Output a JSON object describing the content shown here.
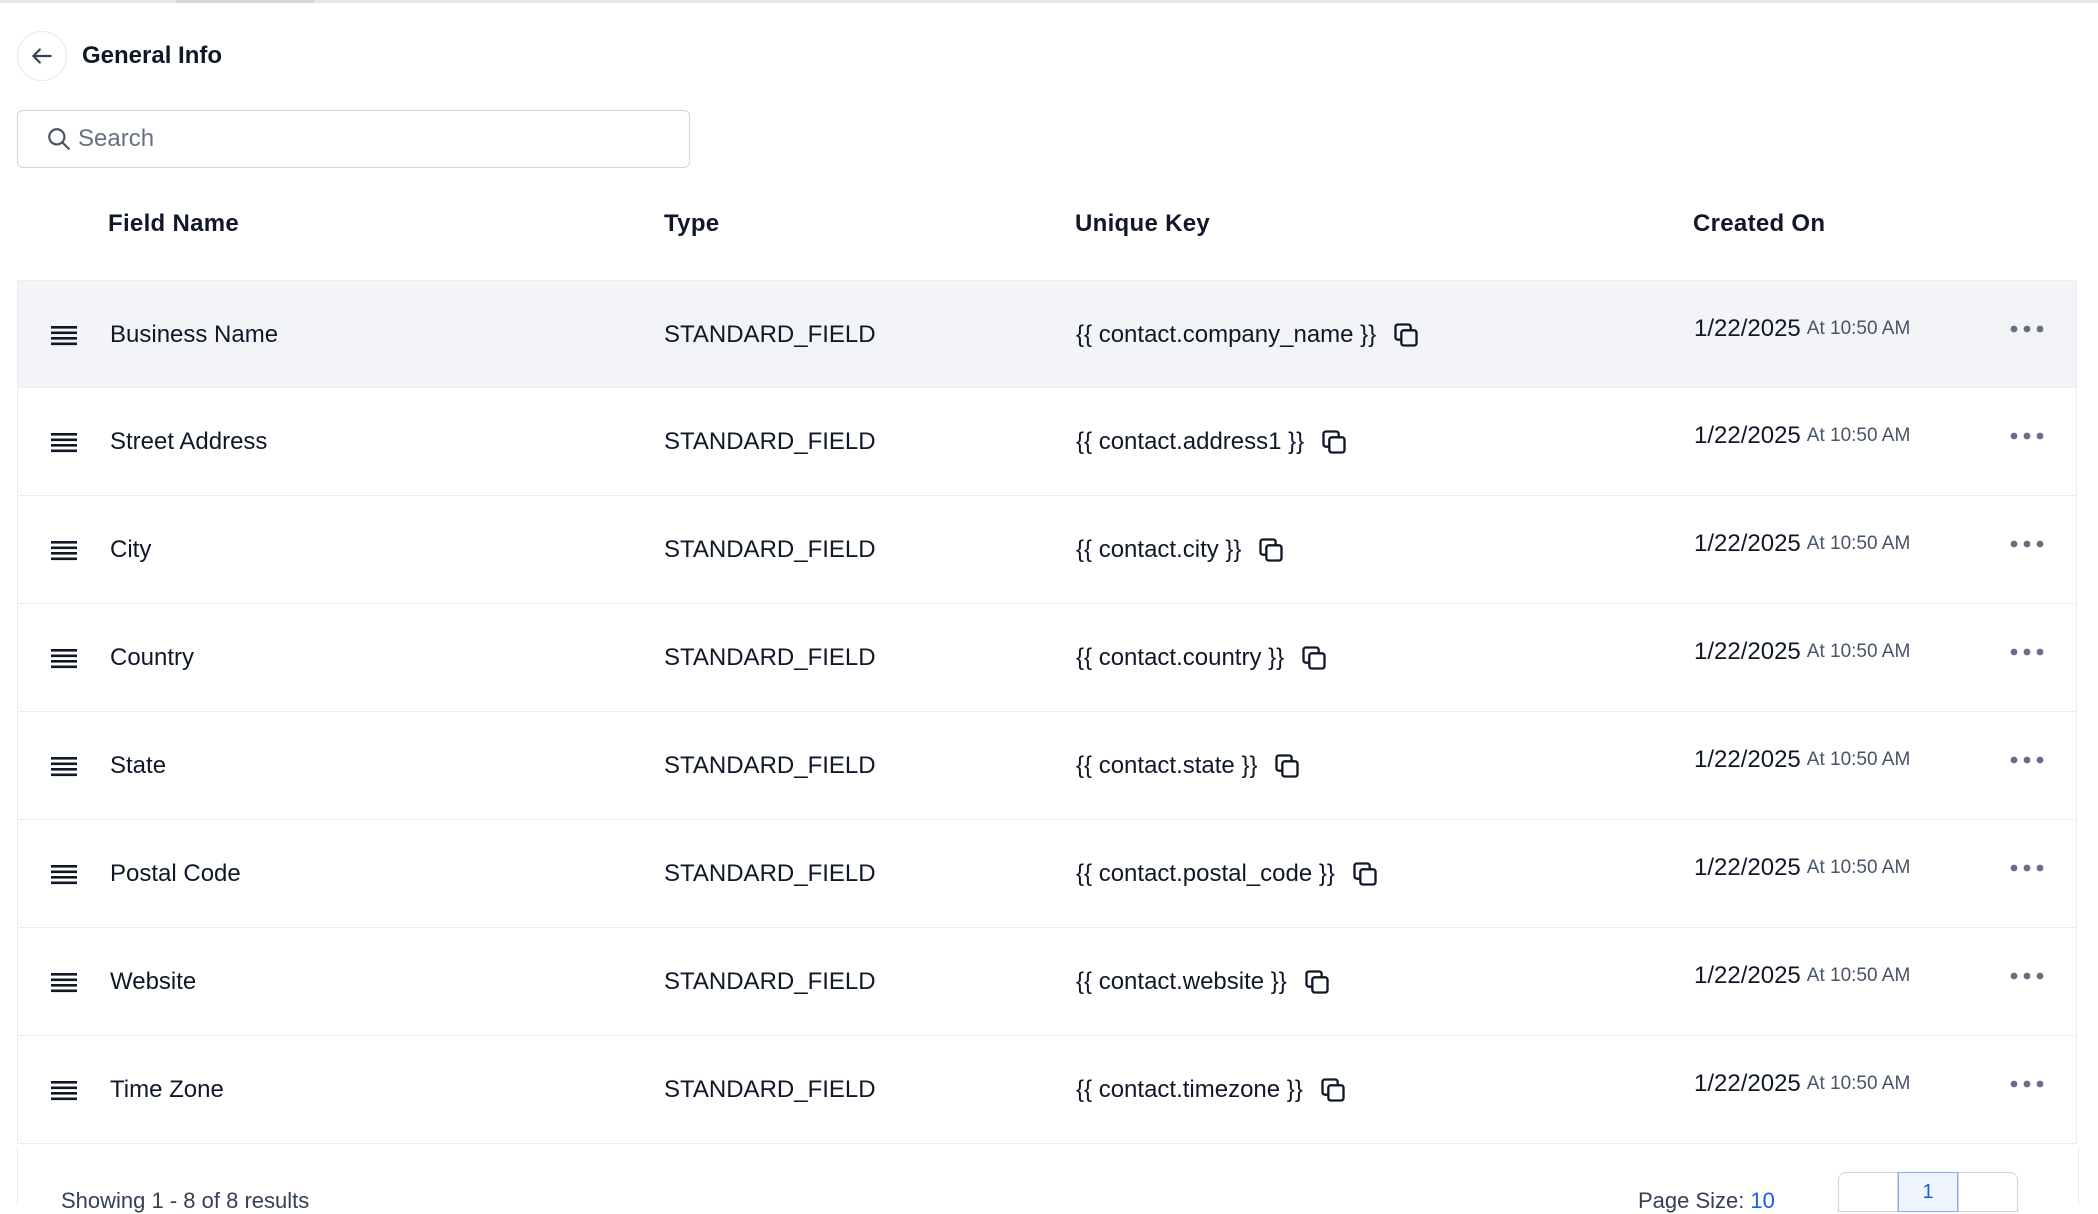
{
  "page": {
    "title": "General Info"
  },
  "search": {
    "placeholder": "Search"
  },
  "table": {
    "headers": {
      "field_name": "Field Name",
      "type": "Type",
      "unique_key": "Unique Key",
      "created_on": "Created On"
    },
    "rows": [
      {
        "name": "Business Name",
        "type": "STANDARD_FIELD",
        "key": "{{ contact.company_name }}",
        "date": "1/22/2025",
        "time": "At 10:50 AM"
      },
      {
        "name": "Street Address",
        "type": "STANDARD_FIELD",
        "key": "{{ contact.address1 }}",
        "date": "1/22/2025",
        "time": "At 10:50 AM"
      },
      {
        "name": "City",
        "type": "STANDARD_FIELD",
        "key": "{{ contact.city }}",
        "date": "1/22/2025",
        "time": "At 10:50 AM"
      },
      {
        "name": "Country",
        "type": "STANDARD_FIELD",
        "key": "{{ contact.country }}",
        "date": "1/22/2025",
        "time": "At 10:50 AM"
      },
      {
        "name": "State",
        "type": "STANDARD_FIELD",
        "key": "{{ contact.state }}",
        "date": "1/22/2025",
        "time": "At 10:50 AM"
      },
      {
        "name": "Postal Code",
        "type": "STANDARD_FIELD",
        "key": "{{ contact.postal_code }}",
        "date": "1/22/2025",
        "time": "At 10:50 AM"
      },
      {
        "name": "Website",
        "type": "STANDARD_FIELD",
        "key": "{{ contact.website }}",
        "date": "1/22/2025",
        "time": "At 10:50 AM"
      },
      {
        "name": "Time Zone",
        "type": "STANDARD_FIELD",
        "key": "{{ contact.timezone }}",
        "date": "1/22/2025",
        "time": "At 10:50 AM"
      }
    ]
  },
  "footer": {
    "showing_text": "Showing 1 - 8 of 8 results",
    "page_size_label": "Page Size:",
    "page_size_value": "10",
    "pages": [
      "",
      "1",
      ""
    ]
  },
  "colors": {
    "selected_row": "#f2f4f7",
    "border": "#eaecf0",
    "accent": "#155eef"
  },
  "icons": {
    "back": "arrow-left-icon",
    "search": "search-icon",
    "drag": "drag-handle-icon",
    "copy": "copy-icon",
    "more": "more-horizontal-icon"
  }
}
